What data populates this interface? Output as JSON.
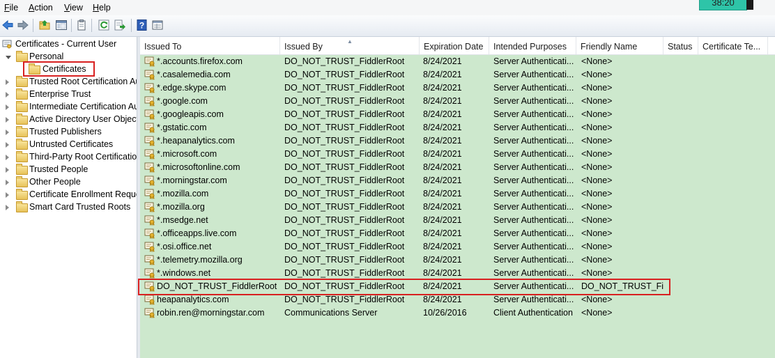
{
  "menu": {
    "items": [
      {
        "label": "File",
        "u": "F",
        "rest": "ile"
      },
      {
        "label": "Action",
        "u": "A",
        "rest": "ction"
      },
      {
        "label": "View",
        "u": "V",
        "rest": "iew"
      },
      {
        "label": "Help",
        "u": "H",
        "rest": "elp"
      }
    ]
  },
  "clock": "38:20",
  "tree": {
    "root": "Certificates - Current User",
    "personal": "Personal",
    "certificates": "Certificates",
    "items": [
      "Trusted Root Certification Authorities",
      "Enterprise Trust",
      "Intermediate Certification Authorities",
      "Active Directory User Object",
      "Trusted Publishers",
      "Untrusted Certificates",
      "Third-Party Root Certification Authorities",
      "Trusted People",
      "Other People",
      "Certificate Enrollment Requests",
      "Smart Card Trusted Roots"
    ]
  },
  "columns": [
    "Issued To",
    "Issued By",
    "Expiration Date",
    "Intended Purposes",
    "Friendly Name",
    "Status",
    "Certificate Te..."
  ],
  "rows": [
    {
      "issued_to": "*.accounts.firefox.com",
      "issued_by": "DO_NOT_TRUST_FiddlerRoot",
      "expiration": "8/24/2021",
      "purposes": "Server Authenticati...",
      "friendly": "<None>"
    },
    {
      "issued_to": "*.casalemedia.com",
      "issued_by": "DO_NOT_TRUST_FiddlerRoot",
      "expiration": "8/24/2021",
      "purposes": "Server Authenticati...",
      "friendly": "<None>"
    },
    {
      "issued_to": "*.edge.skype.com",
      "issued_by": "DO_NOT_TRUST_FiddlerRoot",
      "expiration": "8/24/2021",
      "purposes": "Server Authenticati...",
      "friendly": "<None>"
    },
    {
      "issued_to": "*.google.com",
      "issued_by": "DO_NOT_TRUST_FiddlerRoot",
      "expiration": "8/24/2021",
      "purposes": "Server Authenticati...",
      "friendly": "<None>"
    },
    {
      "issued_to": "*.googleapis.com",
      "issued_by": "DO_NOT_TRUST_FiddlerRoot",
      "expiration": "8/24/2021",
      "purposes": "Server Authenticati...",
      "friendly": "<None>"
    },
    {
      "issued_to": "*.gstatic.com",
      "issued_by": "DO_NOT_TRUST_FiddlerRoot",
      "expiration": "8/24/2021",
      "purposes": "Server Authenticati...",
      "friendly": "<None>"
    },
    {
      "issued_to": "*.heapanalytics.com",
      "issued_by": "DO_NOT_TRUST_FiddlerRoot",
      "expiration": "8/24/2021",
      "purposes": "Server Authenticati...",
      "friendly": "<None>"
    },
    {
      "issued_to": "*.microsoft.com",
      "issued_by": "DO_NOT_TRUST_FiddlerRoot",
      "expiration": "8/24/2021",
      "purposes": "Server Authenticati...",
      "friendly": "<None>"
    },
    {
      "issued_to": "*.microsoftonline.com",
      "issued_by": "DO_NOT_TRUST_FiddlerRoot",
      "expiration": "8/24/2021",
      "purposes": "Server Authenticati...",
      "friendly": "<None>"
    },
    {
      "issued_to": "*.morningstar.com",
      "issued_by": "DO_NOT_TRUST_FiddlerRoot",
      "expiration": "8/24/2021",
      "purposes": "Server Authenticati...",
      "friendly": "<None>"
    },
    {
      "issued_to": "*.mozilla.com",
      "issued_by": "DO_NOT_TRUST_FiddlerRoot",
      "expiration": "8/24/2021",
      "purposes": "Server Authenticati...",
      "friendly": "<None>"
    },
    {
      "issued_to": "*.mozilla.org",
      "issued_by": "DO_NOT_TRUST_FiddlerRoot",
      "expiration": "8/24/2021",
      "purposes": "Server Authenticati...",
      "friendly": "<None>"
    },
    {
      "issued_to": "*.msedge.net",
      "issued_by": "DO_NOT_TRUST_FiddlerRoot",
      "expiration": "8/24/2021",
      "purposes": "Server Authenticati...",
      "friendly": "<None>"
    },
    {
      "issued_to": "*.officeapps.live.com",
      "issued_by": "DO_NOT_TRUST_FiddlerRoot",
      "expiration": "8/24/2021",
      "purposes": "Server Authenticati...",
      "friendly": "<None>"
    },
    {
      "issued_to": "*.osi.office.net",
      "issued_by": "DO_NOT_TRUST_FiddlerRoot",
      "expiration": "8/24/2021",
      "purposes": "Server Authenticati...",
      "friendly": "<None>"
    },
    {
      "issued_to": "*.telemetry.mozilla.org",
      "issued_by": "DO_NOT_TRUST_FiddlerRoot",
      "expiration": "8/24/2021",
      "purposes": "Server Authenticati...",
      "friendly": "<None>"
    },
    {
      "issued_to": "*.windows.net",
      "issued_by": "DO_NOT_TRUST_FiddlerRoot",
      "expiration": "8/24/2021",
      "purposes": "Server Authenticati...",
      "friendly": "<None>"
    },
    {
      "issued_to": "DO_NOT_TRUST_FiddlerRoot",
      "issued_by": "DO_NOT_TRUST_FiddlerRoot",
      "expiration": "8/24/2021",
      "purposes": "Server Authenticati...",
      "friendly": "DO_NOT_TRUST_Fi..."
    },
    {
      "issued_to": "heapanalytics.com",
      "issued_by": "DO_NOT_TRUST_FiddlerRoot",
      "expiration": "8/24/2021",
      "purposes": "Server Authenticati...",
      "friendly": "<None>"
    },
    {
      "issued_to": "robin.ren@morningstar.com",
      "issued_by": "Communications Server",
      "expiration": "10/26/2016",
      "purposes": "Client Authentication",
      "friendly": "<None>"
    }
  ],
  "colors": {
    "list_background": "#cde8cd",
    "highlight_box": "#d82020"
  }
}
